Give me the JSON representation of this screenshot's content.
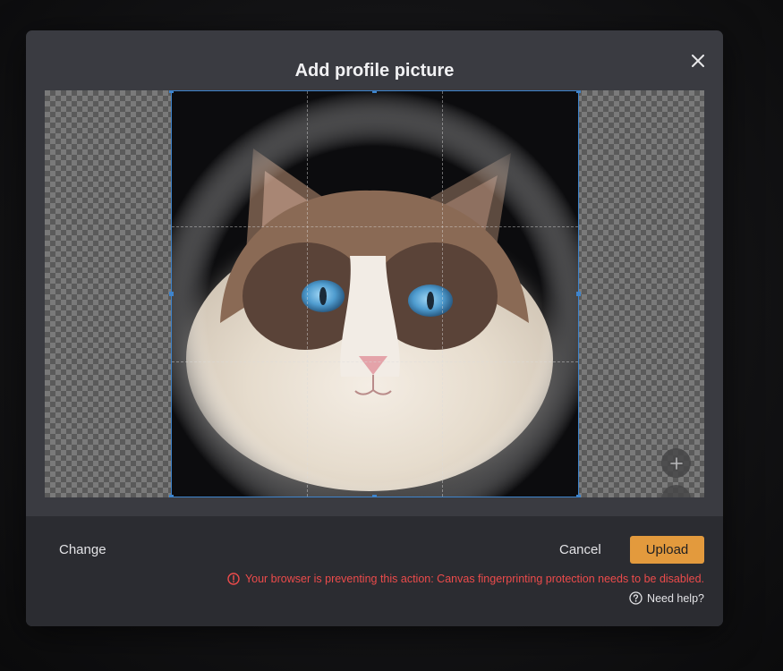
{
  "dialog": {
    "title": "Add profile picture",
    "close_icon": "close-icon"
  },
  "editor": {
    "zoom_in_icon": "plus-icon",
    "zoom_out_icon": "minus-icon"
  },
  "footer": {
    "change_label": "Change",
    "cancel_label": "Cancel",
    "upload_label": "Upload",
    "error_icon": "alert-circle-icon",
    "error_text": "Your browser is preventing this action: Canvas fingerprinting protection needs to be disabled.",
    "help_icon": "question-circle-icon",
    "help_label": "Need help?"
  },
  "colors": {
    "accent": "#e39a3d",
    "error": "#ec4b4b",
    "crop_border": "#3e84cc"
  }
}
